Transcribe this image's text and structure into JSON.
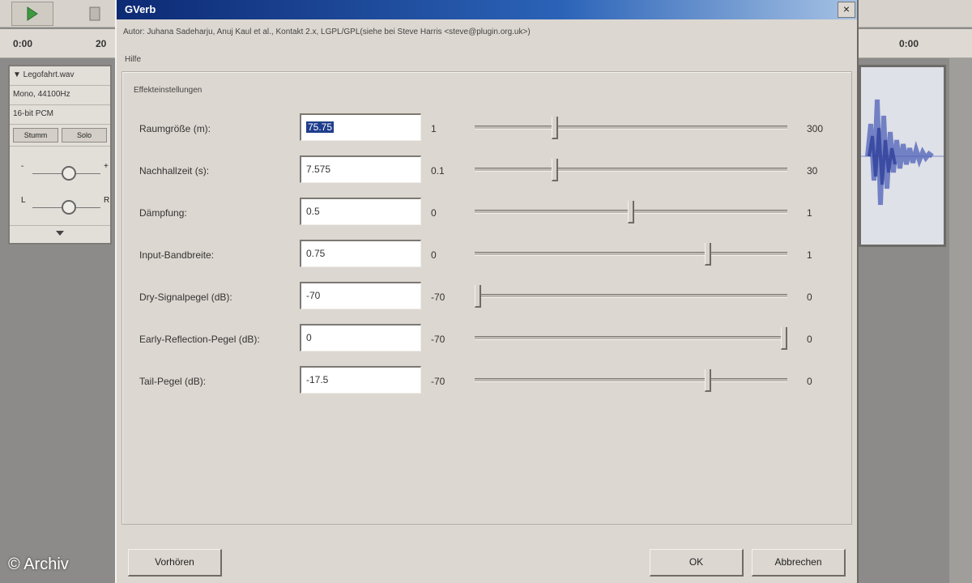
{
  "background_app": {
    "ruler_left": [
      "0:00",
      "20"
    ],
    "ruler_right": "0:00",
    "track": {
      "name": "▼ Legofahrt.wav",
      "info_line1": "Mono, 44100Hz",
      "info_line2": "16-bit PCM",
      "mute_label": "Stumm",
      "solo_label": "Solo",
      "gain_minus": "-",
      "gain_plus": "+",
      "pan_left": "L",
      "pan_right": "R"
    }
  },
  "dialog": {
    "title": "GVerb",
    "close_label": "×",
    "author_line": "Autor: Juhana Sadeharju, Anuj Kaul et al., Kontakt 2.x, LGPL/GPL(siehe bei Steve Harris <steve@plugin.org.uk>)",
    "help_label": "Hilfe",
    "group_title": "Effekteinstellungen",
    "params": [
      {
        "label": "Raumgröße (m):",
        "value": "75.75",
        "min": "1",
        "max": "300",
        "level": 0.25,
        "selected": true
      },
      {
        "label": "Nachhallzeit (s):",
        "value": "7.575",
        "min": "0.1",
        "max": "30",
        "level": 0.25,
        "selected": false
      },
      {
        "label": "Dämpfung:",
        "value": "0.5",
        "min": "0",
        "max": "1",
        "level": 0.5,
        "selected": false
      },
      {
        "label": "Input-Bandbreite:",
        "value": "0.75",
        "min": "0",
        "max": "1",
        "level": 0.75,
        "selected": false
      },
      {
        "label": "Dry-Signalpegel (dB):",
        "value": "-70",
        "min": "-70",
        "max": "0",
        "level": 0.0,
        "selected": false
      },
      {
        "label": "Early-Reflection-Pegel (dB):",
        "value": "0",
        "min": "-70",
        "max": "0",
        "level": 1.0,
        "selected": false
      },
      {
        "label": "Tail-Pegel (dB):",
        "value": "-17.5",
        "min": "-70",
        "max": "0",
        "level": 0.75,
        "selected": false
      }
    ],
    "preview_label": "Vorhören",
    "ok_label": "OK",
    "cancel_label": "Abbrechen"
  },
  "watermark": "© Archiv",
  "colors": {
    "dialog_bg": "#dcd7d0",
    "title_start": "#0d2a74",
    "title_end": "#a6c2e4",
    "selection": "#1f3d8c",
    "waveform": "#4d5fb8"
  }
}
